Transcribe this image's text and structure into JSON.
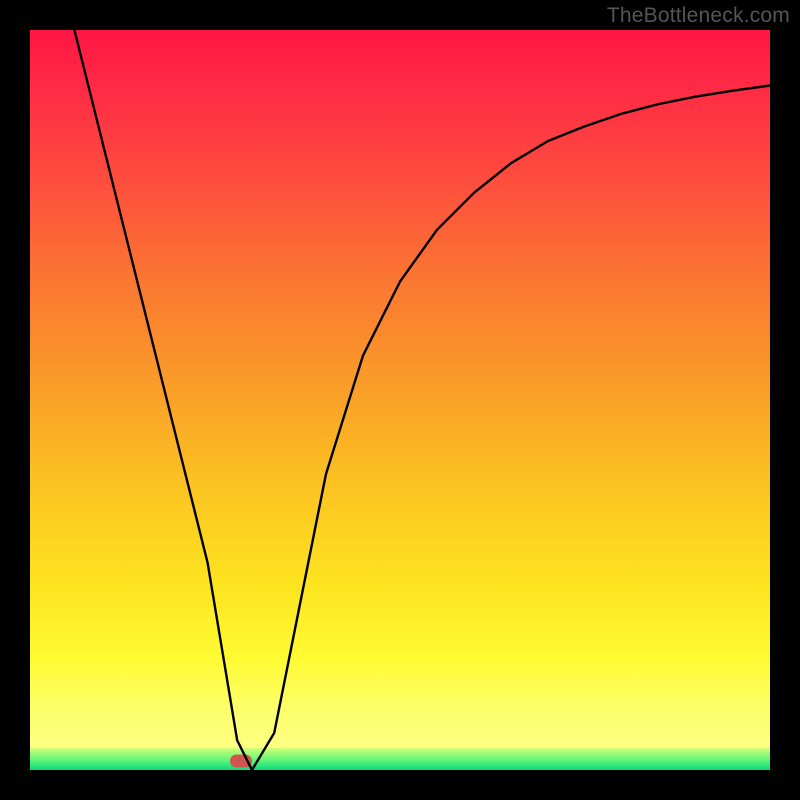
{
  "watermark": "TheBottleneck.com",
  "chart_data": {
    "type": "line",
    "title": "",
    "xlabel": "",
    "ylabel": "",
    "xlim": [
      0,
      100
    ],
    "ylim": [
      0,
      100
    ],
    "grid": false,
    "legend": null,
    "annotations": [],
    "series": [
      {
        "name": "curve",
        "x": [
          6,
          10,
          15,
          20,
          24,
          26,
          28,
          30,
          33,
          36,
          40,
          45,
          50,
          55,
          60,
          65,
          70,
          75,
          80,
          85,
          90,
          95,
          100
        ],
        "y": [
          100,
          84,
          64,
          44,
          28,
          16,
          4,
          0,
          5,
          20,
          40,
          56,
          66,
          73,
          78,
          82,
          85,
          87,
          88.7,
          90,
          91,
          91.8,
          92.5
        ]
      }
    ],
    "marker": {
      "x": 28.5,
      "y": 1.2
    },
    "background_gradient": {
      "top": "#ff1644",
      "middle": "#fbbf22",
      "bottom_yellow": "#ffff8f",
      "green_band_top": "#d4ff7a",
      "green_band_bottom": "#13d877"
    }
  }
}
